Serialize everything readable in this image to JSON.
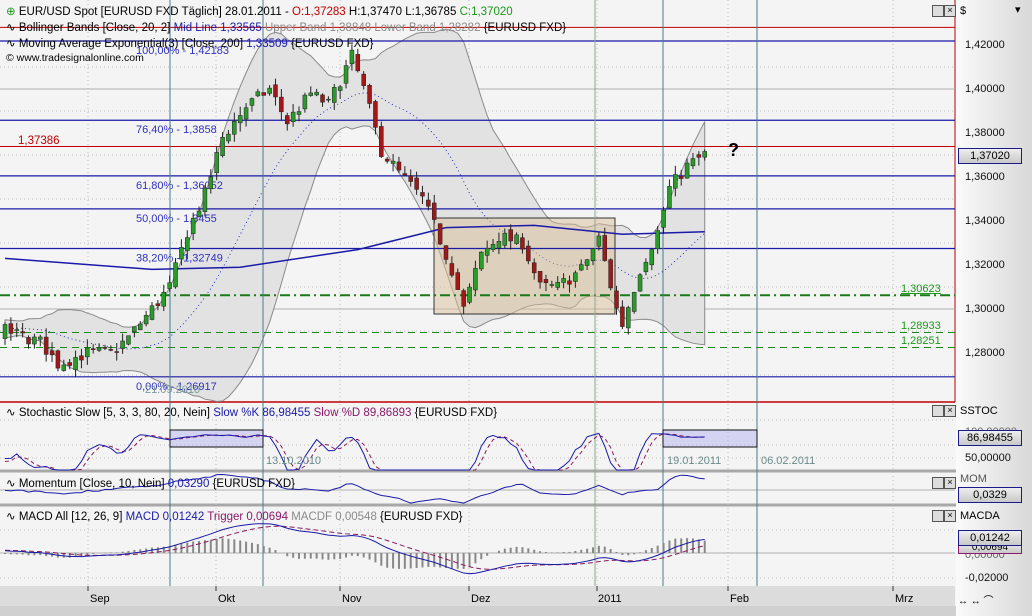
{
  "main_legend": {
    "symbol": "EUR/USD Spot [EURUSD FXD  Täglich] 28.01.2011 -",
    "open": "O:1,37283",
    "high": "H:1,37470",
    "low": "L:1,36785",
    "close": "C:1,37020",
    "bb_prefix": "Bollinger Bands [Close, 20, 2]",
    "bb_mid": "Mid Line 1,33565",
    "bb_bands": "Upper Band 1,38848 Lower Band 1,28282",
    "bb_suffix": "{EURUSD FXD}",
    "ma_prefix": "Moving Average Exponential(3) [Close, 200]",
    "ma_value": "1,33509",
    "ma_suffix": "{EURUSD FXD}",
    "copyright": "© www.tradesignalonline.com"
  },
  "stoch_legend": {
    "prefix": "Stochastic Slow [5, 3, 3, 80, 20, Nein]",
    "k": "Slow %K 86,98455",
    "d": "Slow %D 89,86893",
    "suffix": "{EURUSD FXD}"
  },
  "mom_legend": {
    "prefix": "Momentum [Close, 10, Nein]",
    "value": "0,03290",
    "suffix": "{EURUSD FXD}"
  },
  "macd_legend": {
    "prefix": "MACD All [12, 26, 9]",
    "macd": "MACD 0,01242",
    "trigger": "Trigger 0,00694",
    "macdf": "MACDF 0,00548",
    "suffix": "{EURUSD FXD}"
  },
  "axis": {
    "currency": "$",
    "price_ticks": [
      "1,42000",
      "1,40000",
      "1,38000",
      "1,36000",
      "1,34000",
      "1,32000",
      "1,30000",
      "1,28000"
    ],
    "last_price": "1,37020",
    "stoch_name": "SSTOC",
    "stoch_ticks": [
      "100,00000",
      "50,00000"
    ],
    "stoch_last": "86,98455",
    "mom_name": "MOM",
    "mom_last": "0,0329",
    "macd_name": "MACDA",
    "macd_ticks": [
      "0,00000",
      "-0,02000"
    ],
    "macd_last": "0,01242",
    "macd_trigger": "0,00694"
  },
  "months": [
    "Sep",
    "Okt",
    "Nov",
    "Dez",
    "2011",
    "Feb",
    "Mrz"
  ],
  "annotations": {
    "red_level": "1,37386",
    "question": "?",
    "date1": "21.09.2010",
    "date2": "13.10.2010",
    "date3": "19.01.2011",
    "date4": "06.02.2011",
    "green_levels": [
      "1,30623",
      "1,28933",
      "1,28251"
    ]
  },
  "chart_data": {
    "type": "candlestick",
    "title": "EUR/USD Spot [EURUSD FXD Täglich]",
    "ylim": [
      1.26,
      1.435
    ],
    "fibonacci": [
      {
        "label": "100,00% - 1,42183",
        "v": 1.42183
      },
      {
        "label": "76,40% - 1,3858",
        "v": 1.3858
      },
      {
        "label": "61,80% - 1,36052",
        "v": 1.36052
      },
      {
        "label": "50,00% - 1,3455",
        "v": 1.3455
      },
      {
        "label": "38,20% - 1,32749",
        "v": 1.32749
      },
      {
        "label": "0,00% - 1,26917",
        "v": 1.26917
      }
    ],
    "red_levels": [
      1.37386,
      1.428
    ],
    "green_levels": [
      1.30623,
      1.28933,
      1.28251
    ],
    "approx_close_path": [
      [
        -22,
        1.283
      ],
      [
        -10,
        1.292
      ],
      [
        0,
        1.29
      ],
      [
        6,
        1.285
      ],
      [
        9,
        1.275
      ],
      [
        14,
        1.28
      ],
      [
        18,
        1.28
      ],
      [
        21,
        1.287
      ],
      [
        25,
        1.3
      ],
      [
        28,
        1.31
      ],
      [
        31,
        1.335
      ],
      [
        34,
        1.352
      ],
      [
        37,
        1.378
      ],
      [
        41,
        1.392
      ],
      [
        45,
        1.4
      ],
      [
        48,
        1.385
      ],
      [
        52,
        1.398
      ],
      [
        55,
        1.393
      ],
      [
        59,
        1.415
      ],
      [
        61,
        1.4
      ],
      [
        64,
        1.372
      ],
      [
        67,
        1.362
      ],
      [
        71,
        1.35
      ],
      [
        73,
        1.338
      ],
      [
        76,
        1.318
      ],
      [
        78,
        1.3
      ],
      [
        81,
        1.325
      ],
      [
        84,
        1.333
      ],
      [
        88,
        1.33
      ],
      [
        91,
        1.31
      ],
      [
        94,
        1.31
      ],
      [
        98,
        1.318
      ],
      [
        101,
        1.332
      ],
      [
        104,
        1.3
      ],
      [
        105,
        1.293
      ],
      [
        108,
        1.318
      ],
      [
        111,
        1.335
      ],
      [
        113,
        1.355
      ],
      [
        116,
        1.365
      ],
      [
        119,
        1.3702
      ]
    ],
    "ema200_path": [
      [
        0,
        1.323
      ],
      [
        25,
        1.318
      ],
      [
        40,
        1.319
      ],
      [
        60,
        1.327
      ],
      [
        75,
        1.337
      ],
      [
        90,
        1.338
      ],
      [
        105,
        1.334
      ],
      [
        119,
        1.3351
      ]
    ],
    "last": {
      "open": 1.37283,
      "high": 1.3747,
      "low": 1.36785,
      "close": 1.3702
    }
  }
}
